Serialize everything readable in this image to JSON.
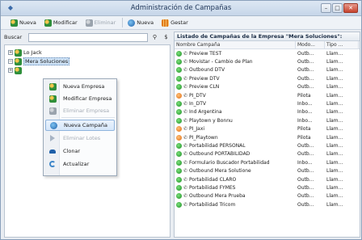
{
  "window": {
    "title": "Administración de Campañas",
    "buttons": {
      "minimize": "–",
      "maximize": "□",
      "close": "✕"
    }
  },
  "toolbar": {
    "new_company": "Nueva",
    "modify": "Modificar",
    "delete": "Eliminar",
    "new_campaign": "Nueva",
    "manage": "Gestar"
  },
  "filter": {
    "label": "Buscar",
    "value": ""
  },
  "tree": {
    "items": [
      {
        "label": "Lo Jack",
        "expander": "+"
      },
      {
        "label": "Mera Soluciones",
        "expander": "−"
      },
      {
        "label": "",
        "expander": "+"
      }
    ]
  },
  "context_menu": {
    "items": [
      {
        "label": "Nueva Empresa",
        "enabled": true
      },
      {
        "label": "Modificar Empresa",
        "enabled": true
      },
      {
        "label": "Eliminar Empresa",
        "enabled": false
      },
      {
        "label": "Nueva Campaña",
        "enabled": true,
        "highlighted": true
      },
      {
        "label": "Eliminar Lotes",
        "enabled": false
      },
      {
        "label": "Clonar",
        "enabled": true
      },
      {
        "label": "Actualizar",
        "enabled": true
      }
    ]
  },
  "panel": {
    "title": "Listado de Campañas de la Empresa \"Mera Soluciones\":",
    "columns": [
      "Nombre Campaña",
      "Modo...",
      "Tipo ..."
    ],
    "rows": [
      {
        "name": "Preview TEST",
        "mode": "Outb...",
        "type": "Llam...",
        "status": "green"
      },
      {
        "name": "Movistar - Cambio de Plan",
        "mode": "Outb...",
        "type": "Llam...",
        "status": "green"
      },
      {
        "name": "Outbound DTV",
        "mode": "Outb...",
        "type": "Llam...",
        "status": "green"
      },
      {
        "name": "Preview DTV",
        "mode": "Outb...",
        "type": "Llam...",
        "status": "green"
      },
      {
        "name": "Preview CLN",
        "mode": "Outb...",
        "type": "Llam...",
        "status": "green"
      },
      {
        "name": "PI_DTV",
        "mode": "Pilota",
        "type": "Llam...",
        "status": "orange"
      },
      {
        "name": "In_DTV",
        "mode": "Inbo...",
        "type": "Llam...",
        "status": "green"
      },
      {
        "name": "Ind Argentina",
        "mode": "Inbo...",
        "type": "Llam...",
        "status": "green"
      },
      {
        "name": "Playtown y Bonnu",
        "mode": "Inbo...",
        "type": "Llam...",
        "status": "green"
      },
      {
        "name": "PI_Jaxi",
        "mode": "Pilota",
        "type": "Llam...",
        "status": "orange"
      },
      {
        "name": "PI_Playtown",
        "mode": "Pilota",
        "type": "Llam...",
        "status": "orange"
      },
      {
        "name": "Portabilidad PERSONAL",
        "mode": "Outb...",
        "type": "Llam...",
        "status": "green"
      },
      {
        "name": "Outbound PORTABILIDAD",
        "mode": "Outb...",
        "type": "Llam...",
        "status": "green"
      },
      {
        "name": "Formulario Buscador Portabilidad",
        "mode": "Inbo...",
        "type": "Llam...",
        "status": "green"
      },
      {
        "name": "Outbound Mera Solutione",
        "mode": "Outb...",
        "type": "Llam...",
        "status": "green"
      },
      {
        "name": "Portabilidad CLARO",
        "mode": "Outb...",
        "type": "Llam...",
        "status": "green"
      },
      {
        "name": "Portabilidad FYMES",
        "mode": "Outb...",
        "type": "Llam...",
        "status": "green"
      },
      {
        "name": "Outbound Mera Prueba",
        "mode": "Outb...",
        "type": "Llam...",
        "status": "green"
      },
      {
        "name": "Portabilidad Tricom",
        "mode": "Outb...",
        "type": "Llam...",
        "status": "green"
      }
    ]
  },
  "colors": {
    "accent": "#1e5fa8",
    "status_green": "#178a1f",
    "status_orange": "#e06a10"
  }
}
